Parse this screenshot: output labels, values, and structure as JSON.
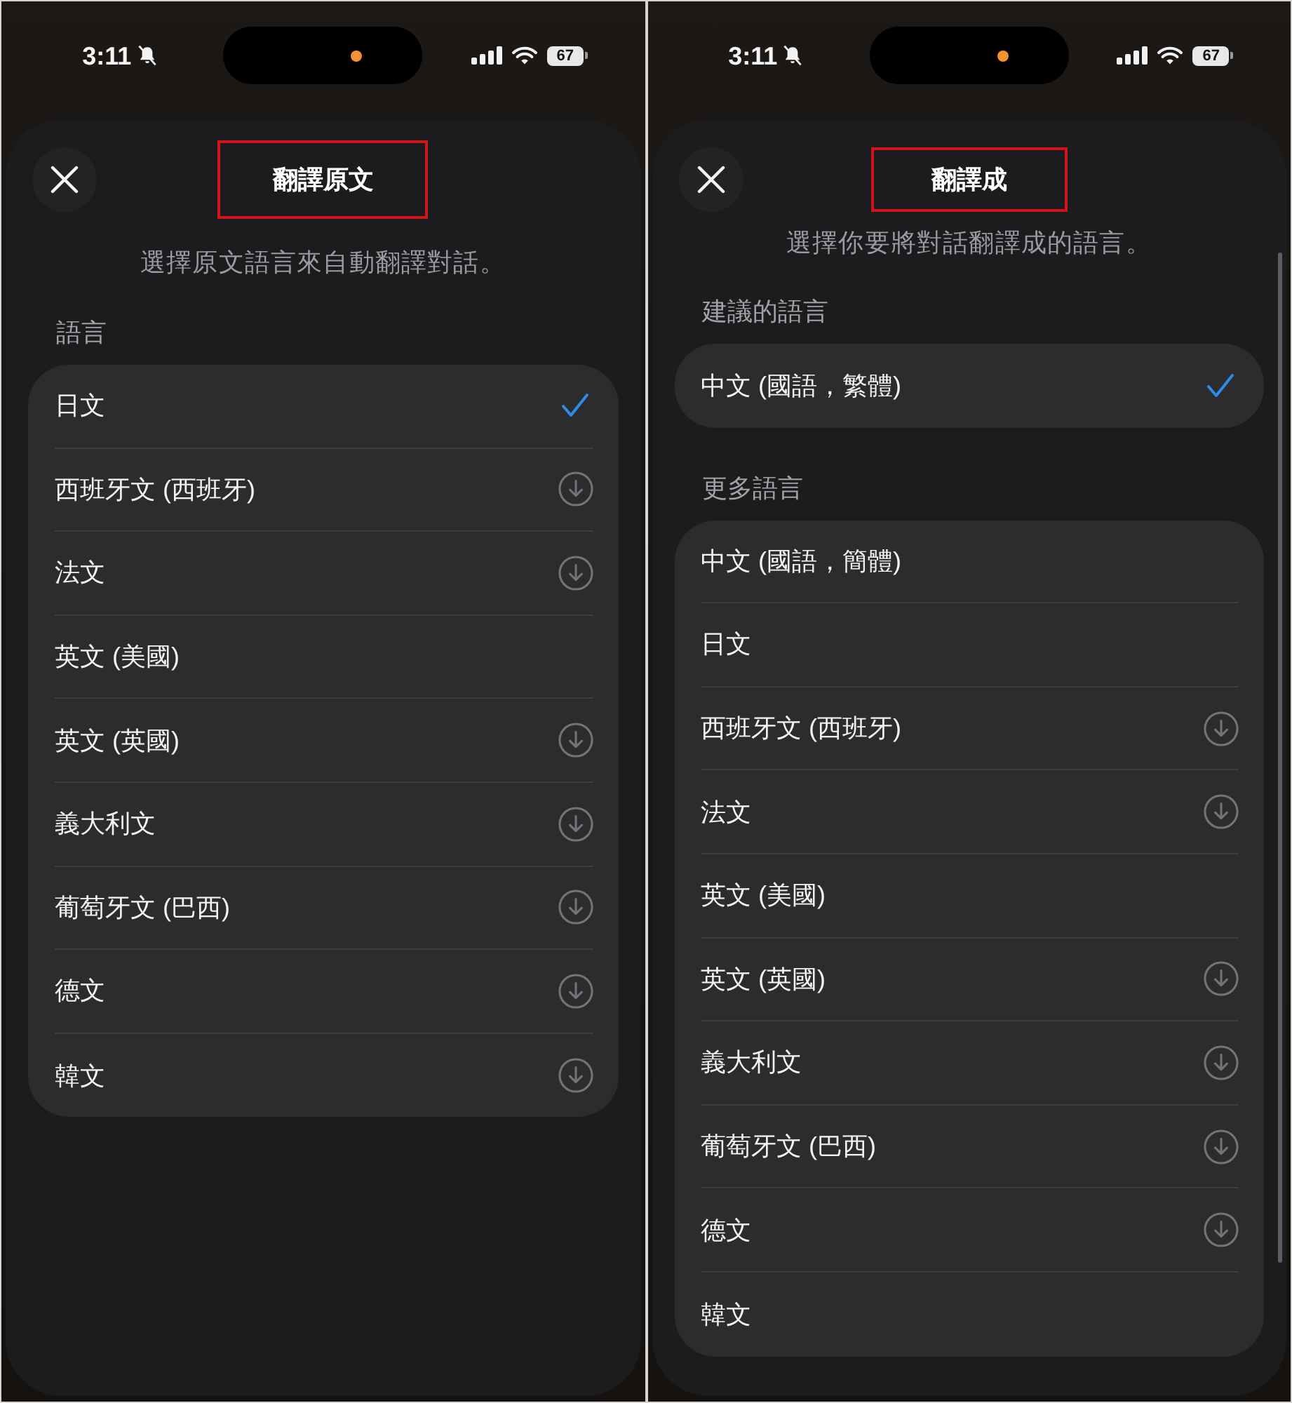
{
  "panels": [
    {
      "status_bar": {
        "time": "3:11",
        "battery": "67"
      },
      "sheet": {
        "title": "翻譯原文",
        "title_highlighted": true,
        "subtitle": "選擇原文語言來自動翻譯對話。",
        "sections": [
          {
            "label": "語言",
            "items": [
              {
                "label": "日文",
                "selected": true,
                "download": false
              },
              {
                "label": "西班牙文 (西班牙)",
                "selected": false,
                "download": true
              },
              {
                "label": "法文",
                "selected": false,
                "download": true
              },
              {
                "label": "英文 (美國)",
                "selected": false,
                "download": false
              },
              {
                "label": "英文 (英國)",
                "selected": false,
                "download": true
              },
              {
                "label": "義大利文",
                "selected": false,
                "download": true
              },
              {
                "label": "葡萄牙文 (巴西)",
                "selected": false,
                "download": true
              },
              {
                "label": "德文",
                "selected": false,
                "download": true
              },
              {
                "label": "韓文",
                "selected": false,
                "download": true
              }
            ]
          }
        ]
      }
    },
    {
      "status_bar": {
        "time": "3:11",
        "battery": "67"
      },
      "sheet": {
        "title": "翻譯成",
        "title_highlighted": true,
        "subtitle": "選擇你要將對話翻譯成的語言。",
        "scrollbar": true,
        "sections": [
          {
            "label": "建議的語言",
            "items": [
              {
                "label": "中文 (國語，繁體)",
                "selected": true,
                "download": false
              }
            ]
          },
          {
            "label": "更多語言",
            "items": [
              {
                "label": "中文 (國語，簡體)",
                "selected": false,
                "download": false
              },
              {
                "label": "日文",
                "selected": false,
                "download": false
              },
              {
                "label": "西班牙文 (西班牙)",
                "selected": false,
                "download": true
              },
              {
                "label": "法文",
                "selected": false,
                "download": true
              },
              {
                "label": "英文 (美國)",
                "selected": false,
                "download": false
              },
              {
                "label": "英文 (英國)",
                "selected": false,
                "download": true
              },
              {
                "label": "義大利文",
                "selected": false,
                "download": true
              },
              {
                "label": "葡萄牙文 (巴西)",
                "selected": false,
                "download": true
              },
              {
                "label": "德文",
                "selected": false,
                "download": true
              },
              {
                "label": "韓文",
                "selected": false,
                "download": false
              }
            ]
          }
        ]
      }
    }
  ]
}
